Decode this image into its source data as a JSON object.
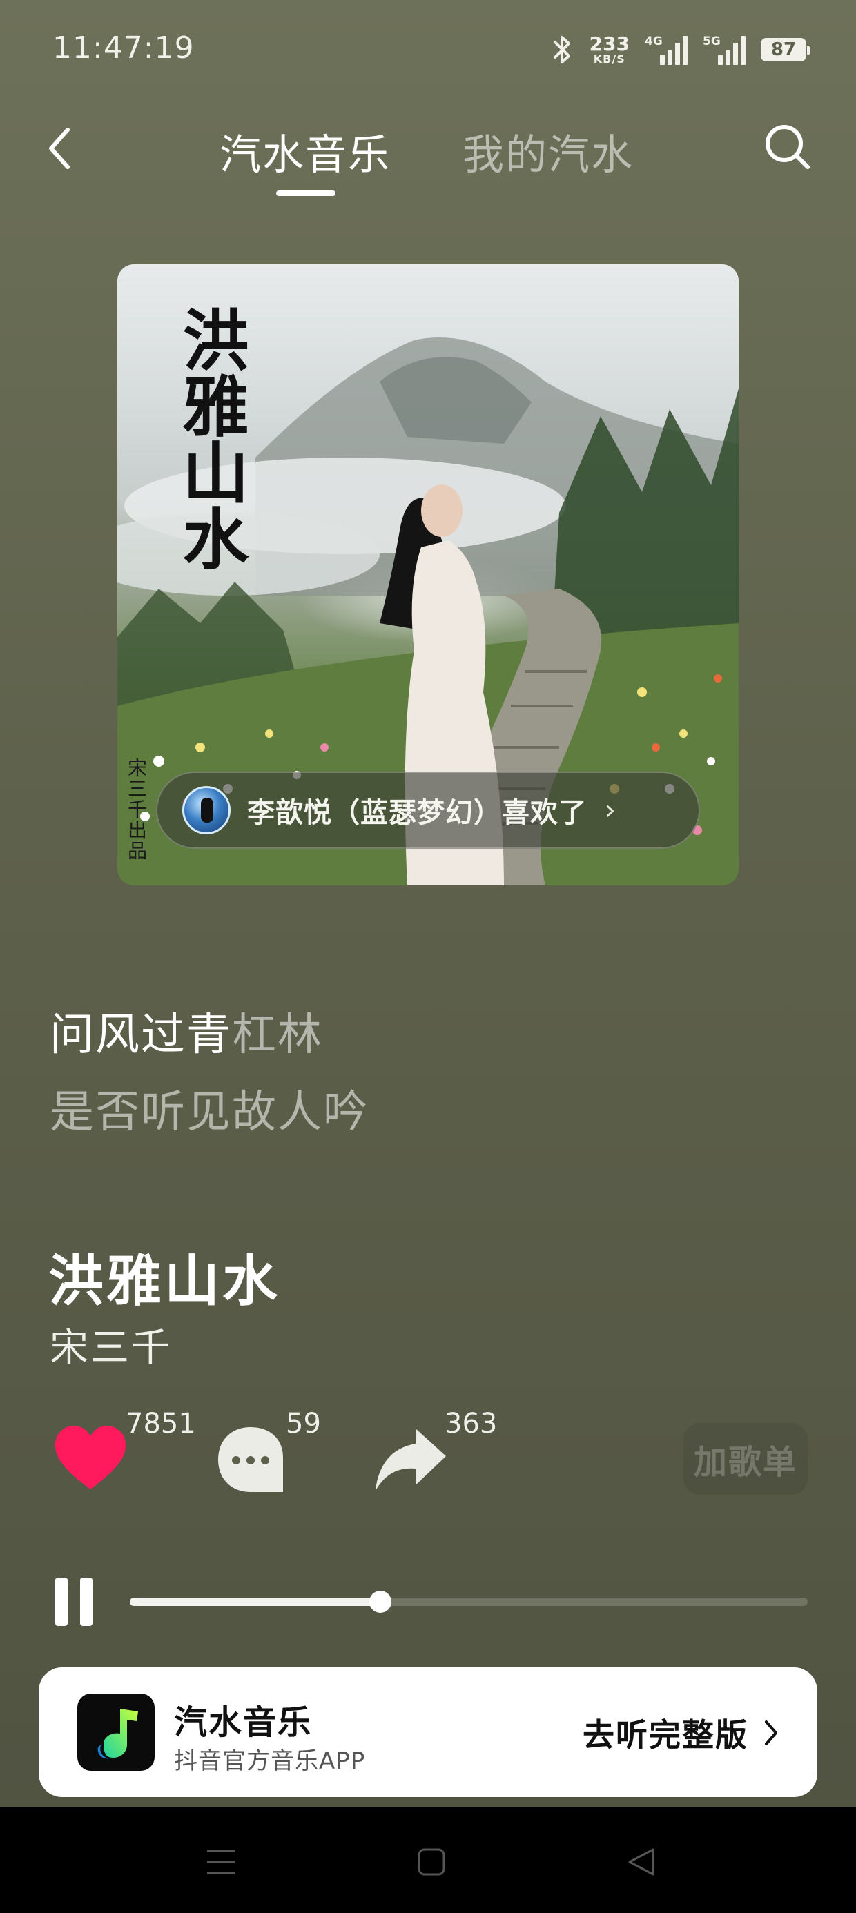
{
  "status_bar": {
    "time": "11:47:19",
    "net_speed": "233",
    "net_unit": "KB/S",
    "sim1_tag": "4G",
    "sim2_tag": "5G",
    "battery": "87",
    "icons": [
      "bluetooth-icon",
      "signal-4g-icon",
      "signal-5g-icon",
      "battery-icon"
    ]
  },
  "header": {
    "tabs": [
      {
        "label": "汽水音乐",
        "active": true
      },
      {
        "label": "我的汽水",
        "active": false
      }
    ],
    "icons": [
      "back-icon",
      "search-icon"
    ]
  },
  "album": {
    "cover_title": "洪雅山水",
    "cover_credit": "宋三千出品",
    "liked_by": "李歆悦（蓝瑟梦幻）喜欢了",
    "liked_chevron": "›"
  },
  "lyrics": {
    "current_sung": "问风过青",
    "current_unsung": "杠林",
    "next": "是否听见故人吟"
  },
  "song": {
    "title": "洪雅山水",
    "artist": "宋三千"
  },
  "actions": {
    "like_count": "7851",
    "comment_count": "59",
    "share_count": "363",
    "add_playlist_label": "加歌单",
    "like_color": "#ff1a5e"
  },
  "player": {
    "progress": 0.37,
    "state": "playing"
  },
  "banner": {
    "app_name": "汽水音乐",
    "app_subtitle": "抖音官方音乐APP",
    "cta_label": "去听完整版"
  },
  "nav": {
    "icons": [
      "menu-icon",
      "home-icon",
      "back-triangle-icon"
    ]
  }
}
